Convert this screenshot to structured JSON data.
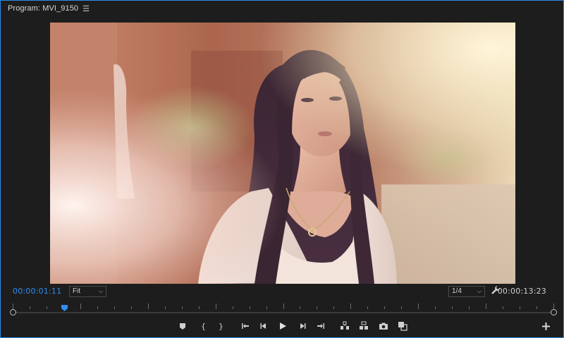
{
  "panel": {
    "title": "Program: MVI_9150",
    "menu_icon": "hamburger-icon"
  },
  "controls": {
    "current_timecode": "00:00:01:11",
    "duration_timecode": "00:00:13:23",
    "zoom_level": "Fit",
    "playback_resolution": "1/4",
    "playhead_fraction": 0.096
  },
  "transport_buttons": [
    {
      "name": "add-marker-button",
      "icon": "marker-icon"
    },
    {
      "name": "mark-in-button",
      "icon": "mark-in-icon"
    },
    {
      "name": "mark-out-button",
      "icon": "mark-out-icon"
    },
    {
      "name": "go-to-in-button",
      "icon": "go-to-in-icon"
    },
    {
      "name": "step-back-button",
      "icon": "step-back-icon"
    },
    {
      "name": "play-button",
      "icon": "play-icon"
    },
    {
      "name": "step-forward-button",
      "icon": "step-forward-icon"
    },
    {
      "name": "go-to-out-button",
      "icon": "go-to-out-icon"
    },
    {
      "name": "lift-button",
      "icon": "lift-icon"
    },
    {
      "name": "extract-button",
      "icon": "extract-icon"
    },
    {
      "name": "export-frame-button",
      "icon": "camera-icon"
    },
    {
      "name": "compare-view-button",
      "icon": "compare-icon"
    }
  ],
  "colors": {
    "accent": "#2d8ceb",
    "timecode_active": "#2f8df0",
    "background": "#1d1d1d"
  }
}
